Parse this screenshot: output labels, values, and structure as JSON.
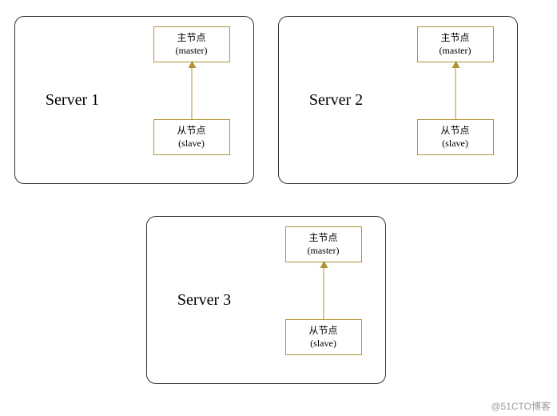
{
  "diagram": {
    "boxColor": "#b19230",
    "servers": [
      {
        "label": "Server 1",
        "master": {
          "line1": "主节点",
          "line2": "(master)"
        },
        "slave": {
          "line1": "从节点",
          "line2": "(slave)"
        }
      },
      {
        "label": "Server 2",
        "master": {
          "line1": "主节点",
          "line2": "(master)"
        },
        "slave": {
          "line1": "从节点",
          "line2": "(slave)"
        }
      },
      {
        "label": "Server 3",
        "master": {
          "line1": "主节点",
          "line2": "(master)"
        },
        "slave": {
          "line1": "从节点",
          "line2": "(slave)"
        }
      }
    ],
    "relation": "slave_points_to_master"
  },
  "watermark": "@51CTO博客"
}
